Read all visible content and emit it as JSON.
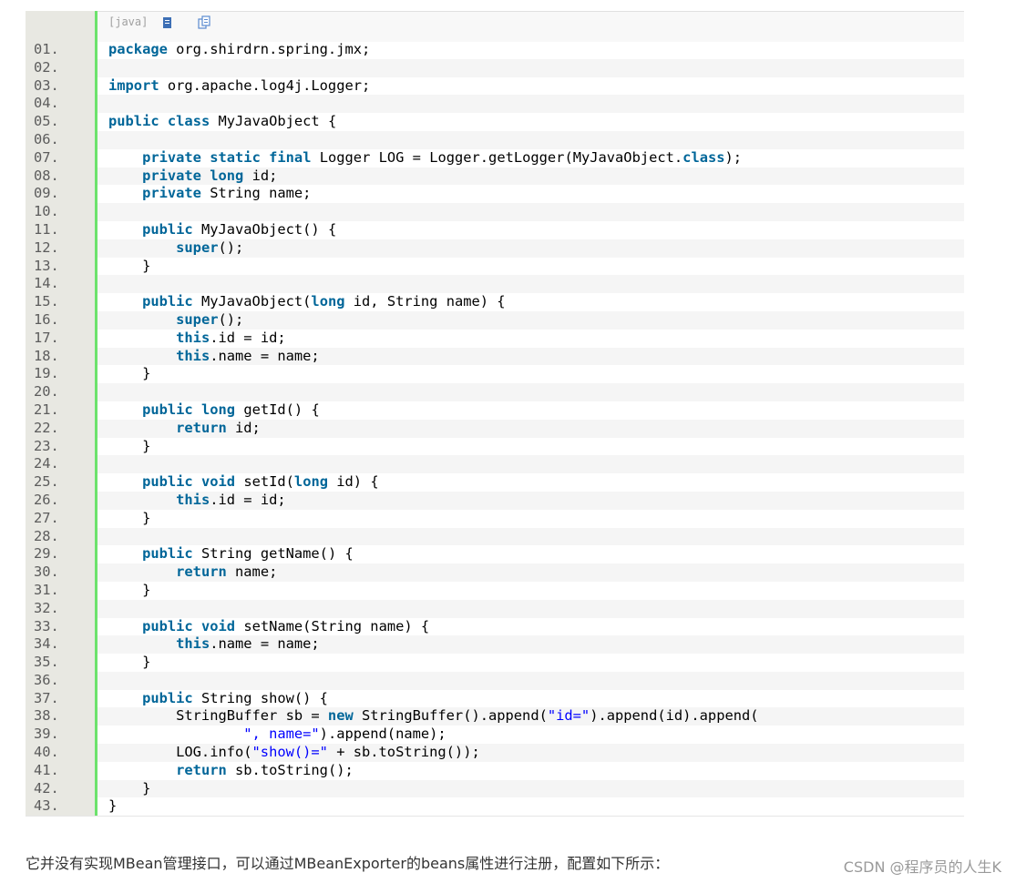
{
  "toolbar": {
    "language_label": "[java]"
  },
  "lines": [
    {
      "n": "01.",
      "t": [
        {
          "k": 1,
          "s": "package"
        },
        {
          "s": " org.shirdrn.spring.jmx;"
        }
      ]
    },
    {
      "n": "02.",
      "t": []
    },
    {
      "n": "03.",
      "t": [
        {
          "k": 1,
          "s": "import"
        },
        {
          "s": " org.apache.log4j.Logger;"
        }
      ]
    },
    {
      "n": "04.",
      "t": []
    },
    {
      "n": "05.",
      "t": [
        {
          "k": 1,
          "s": "public"
        },
        {
          "s": " "
        },
        {
          "k": 1,
          "s": "class"
        },
        {
          "s": " MyJavaObject {"
        }
      ]
    },
    {
      "n": "06.",
      "t": []
    },
    {
      "n": "07.",
      "t": [
        {
          "s": "    "
        },
        {
          "k": 1,
          "s": "private"
        },
        {
          "s": " "
        },
        {
          "k": 1,
          "s": "static"
        },
        {
          "s": " "
        },
        {
          "k": 1,
          "s": "final"
        },
        {
          "s": " Logger LOG = Logger.getLogger(MyJavaObject."
        },
        {
          "k": 1,
          "s": "class"
        },
        {
          "s": ");"
        }
      ]
    },
    {
      "n": "08.",
      "t": [
        {
          "s": "    "
        },
        {
          "k": 1,
          "s": "private"
        },
        {
          "s": " "
        },
        {
          "k": 1,
          "s": "long"
        },
        {
          "s": " id;"
        }
      ]
    },
    {
      "n": "09.",
      "t": [
        {
          "s": "    "
        },
        {
          "k": 1,
          "s": "private"
        },
        {
          "s": " String name;"
        }
      ]
    },
    {
      "n": "10.",
      "t": []
    },
    {
      "n": "11.",
      "t": [
        {
          "s": "    "
        },
        {
          "k": 1,
          "s": "public"
        },
        {
          "s": " MyJavaObject() {"
        }
      ]
    },
    {
      "n": "12.",
      "t": [
        {
          "s": "        "
        },
        {
          "k": 1,
          "s": "super"
        },
        {
          "s": "();"
        }
      ]
    },
    {
      "n": "13.",
      "t": [
        {
          "s": "    }"
        }
      ]
    },
    {
      "n": "14.",
      "t": []
    },
    {
      "n": "15.",
      "t": [
        {
          "s": "    "
        },
        {
          "k": 1,
          "s": "public"
        },
        {
          "s": " MyJavaObject("
        },
        {
          "k": 1,
          "s": "long"
        },
        {
          "s": " id, String name) {"
        }
      ]
    },
    {
      "n": "16.",
      "t": [
        {
          "s": "        "
        },
        {
          "k": 1,
          "s": "super"
        },
        {
          "s": "();"
        }
      ]
    },
    {
      "n": "17.",
      "t": [
        {
          "s": "        "
        },
        {
          "k": 1,
          "s": "this"
        },
        {
          "s": ".id = id;"
        }
      ]
    },
    {
      "n": "18.",
      "t": [
        {
          "s": "        "
        },
        {
          "k": 1,
          "s": "this"
        },
        {
          "s": ".name = name;"
        }
      ]
    },
    {
      "n": "19.",
      "t": [
        {
          "s": "    }"
        }
      ]
    },
    {
      "n": "20.",
      "t": []
    },
    {
      "n": "21.",
      "t": [
        {
          "s": "    "
        },
        {
          "k": 1,
          "s": "public"
        },
        {
          "s": " "
        },
        {
          "k": 1,
          "s": "long"
        },
        {
          "s": " getId() {"
        }
      ]
    },
    {
      "n": "22.",
      "t": [
        {
          "s": "        "
        },
        {
          "k": 1,
          "s": "return"
        },
        {
          "s": " id;"
        }
      ]
    },
    {
      "n": "23.",
      "t": [
        {
          "s": "    }"
        }
      ]
    },
    {
      "n": "24.",
      "t": []
    },
    {
      "n": "25.",
      "t": [
        {
          "s": "    "
        },
        {
          "k": 1,
          "s": "public"
        },
        {
          "s": " "
        },
        {
          "k": 1,
          "s": "void"
        },
        {
          "s": " setId("
        },
        {
          "k": 1,
          "s": "long"
        },
        {
          "s": " id) {"
        }
      ]
    },
    {
      "n": "26.",
      "t": [
        {
          "s": "        "
        },
        {
          "k": 1,
          "s": "this"
        },
        {
          "s": ".id = id;"
        }
      ]
    },
    {
      "n": "27.",
      "t": [
        {
          "s": "    }"
        }
      ]
    },
    {
      "n": "28.",
      "t": []
    },
    {
      "n": "29.",
      "t": [
        {
          "s": "    "
        },
        {
          "k": 1,
          "s": "public"
        },
        {
          "s": " String getName() {"
        }
      ]
    },
    {
      "n": "30.",
      "t": [
        {
          "s": "        "
        },
        {
          "k": 1,
          "s": "return"
        },
        {
          "s": " name;"
        }
      ]
    },
    {
      "n": "31.",
      "t": [
        {
          "s": "    }"
        }
      ]
    },
    {
      "n": "32.",
      "t": []
    },
    {
      "n": "33.",
      "t": [
        {
          "s": "    "
        },
        {
          "k": 1,
          "s": "public"
        },
        {
          "s": " "
        },
        {
          "k": 1,
          "s": "void"
        },
        {
          "s": " setName(String name) {"
        }
      ]
    },
    {
      "n": "34.",
      "t": [
        {
          "s": "        "
        },
        {
          "k": 1,
          "s": "this"
        },
        {
          "s": ".name = name;"
        }
      ]
    },
    {
      "n": "35.",
      "t": [
        {
          "s": "    }"
        }
      ]
    },
    {
      "n": "36.",
      "t": []
    },
    {
      "n": "37.",
      "t": [
        {
          "s": "    "
        },
        {
          "k": 1,
          "s": "public"
        },
        {
          "s": " String show() {"
        }
      ]
    },
    {
      "n": "38.",
      "t": [
        {
          "s": "        StringBuffer sb = "
        },
        {
          "k": 1,
          "s": "new"
        },
        {
          "s": " StringBuffer().append("
        },
        {
          "q": 1,
          "s": "\"id=\""
        },
        {
          "s": ").append(id).append("
        }
      ]
    },
    {
      "n": "39.",
      "t": [
        {
          "s": "                "
        },
        {
          "q": 1,
          "s": "\", name=\""
        },
        {
          "s": ").append(name);"
        }
      ]
    },
    {
      "n": "40.",
      "t": [
        {
          "s": "        LOG.info("
        },
        {
          "q": 1,
          "s": "\"show()=\""
        },
        {
          "s": " + sb.toString());"
        }
      ]
    },
    {
      "n": "41.",
      "t": [
        {
          "s": "        "
        },
        {
          "k": 1,
          "s": "return"
        },
        {
          "s": " sb.toString();"
        }
      ]
    },
    {
      "n": "42.",
      "t": [
        {
          "s": "    }"
        }
      ]
    },
    {
      "n": "43.",
      "t": [
        {
          "s": "}"
        }
      ]
    }
  ],
  "footer": {
    "text": "它并没有实现MBean管理接口，可以通过MBeanExporter的beans属性进行注册，配置如下所示：",
    "watermark": "CSDN @程序员的人生K"
  },
  "colors": {
    "keyword": "#006699",
    "string": "#0000ff",
    "gutter_border": "#6ce26c"
  },
  "icons": [
    "view-source-icon",
    "copy-to-clipboard-icon"
  ]
}
